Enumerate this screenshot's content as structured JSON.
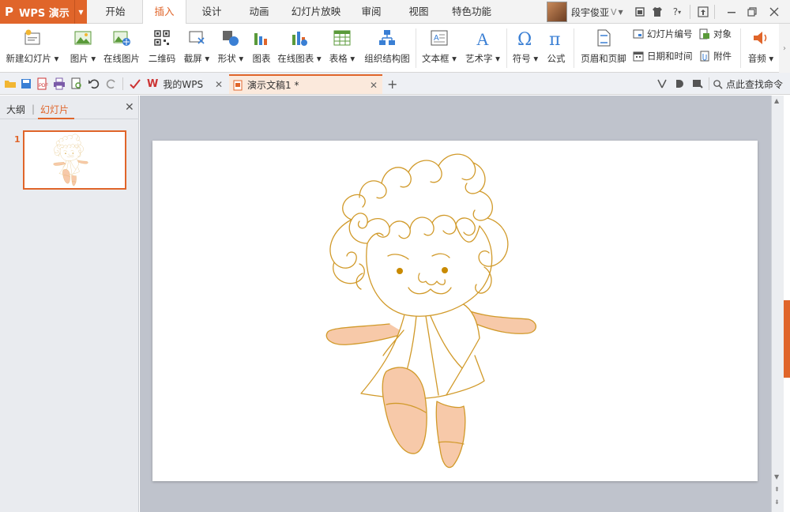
{
  "app": {
    "name": "WPS 演示",
    "logo": "P"
  },
  "menu": {
    "tabs": [
      {
        "label": "开始"
      },
      {
        "label": "插入"
      },
      {
        "label": "设计"
      },
      {
        "label": "动画"
      },
      {
        "label": "幻灯片放映"
      },
      {
        "label": "审阅"
      },
      {
        "label": "视图"
      },
      {
        "label": "特色功能"
      }
    ],
    "active_tab": "插入",
    "user_name": "段宇俊亚",
    "vip_badge": "V"
  },
  "ribbon": {
    "new_slide": "新建幻灯片",
    "picture": "图片",
    "online_picture": "在线图片",
    "qrcode": "二维码",
    "screenshot": "截屏",
    "shape": "形状",
    "chart": "图表",
    "online_chart": "在线图表",
    "table": "表格",
    "org_chart": "组织结构图",
    "textbox": "文本框",
    "wordart": "艺术字",
    "symbol": "符号",
    "formula": "公式",
    "header_footer": "页眉和页脚",
    "slide_number": "幻灯片编号",
    "object": "对象",
    "datetime": "日期和时间",
    "attachment": "附件",
    "audio": "音频"
  },
  "quickbar": {
    "tab_mywps": "我的WPS",
    "tab_doc": "演示文稿1 *",
    "find_command": "点此查找命令"
  },
  "left_panel": {
    "tab_outline": "大纲",
    "tab_slides": "幻灯片",
    "slide_number": "1"
  },
  "colors": {
    "accent": "#e0652a",
    "line_art": "#d19a2a",
    "skin_fill": "#f7c9a9",
    "eye": "#c98a00"
  }
}
